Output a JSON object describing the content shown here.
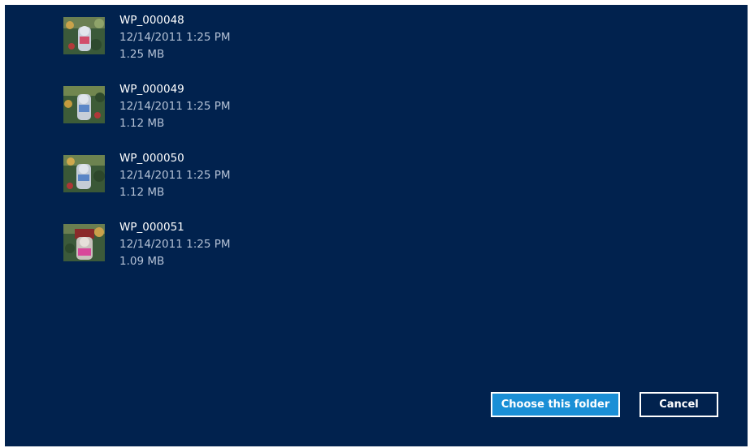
{
  "files": [
    {
      "name": "WP_000048",
      "date": "12/14/2011 1:25 PM",
      "size": "1.25 MB",
      "thumbnail": "photo-thumbnail"
    },
    {
      "name": "WP_000049",
      "date": "12/14/2011 1:25 PM",
      "size": "1.12 MB",
      "thumbnail": "photo-thumbnail"
    },
    {
      "name": "WP_000050",
      "date": "12/14/2011 1:25 PM",
      "size": "1.12 MB",
      "thumbnail": "photo-thumbnail"
    },
    {
      "name": "WP_000051",
      "date": "12/14/2011 1:25 PM",
      "size": "1.09 MB",
      "thumbnail": "photo-thumbnail"
    }
  ],
  "actions": {
    "choose_label": "Choose this folder",
    "cancel_label": "Cancel"
  },
  "colors": {
    "background": "#01224e",
    "primary_button": "#1a8fd6",
    "text": "#ffffff",
    "secondary_text": "#b5c2d6"
  }
}
